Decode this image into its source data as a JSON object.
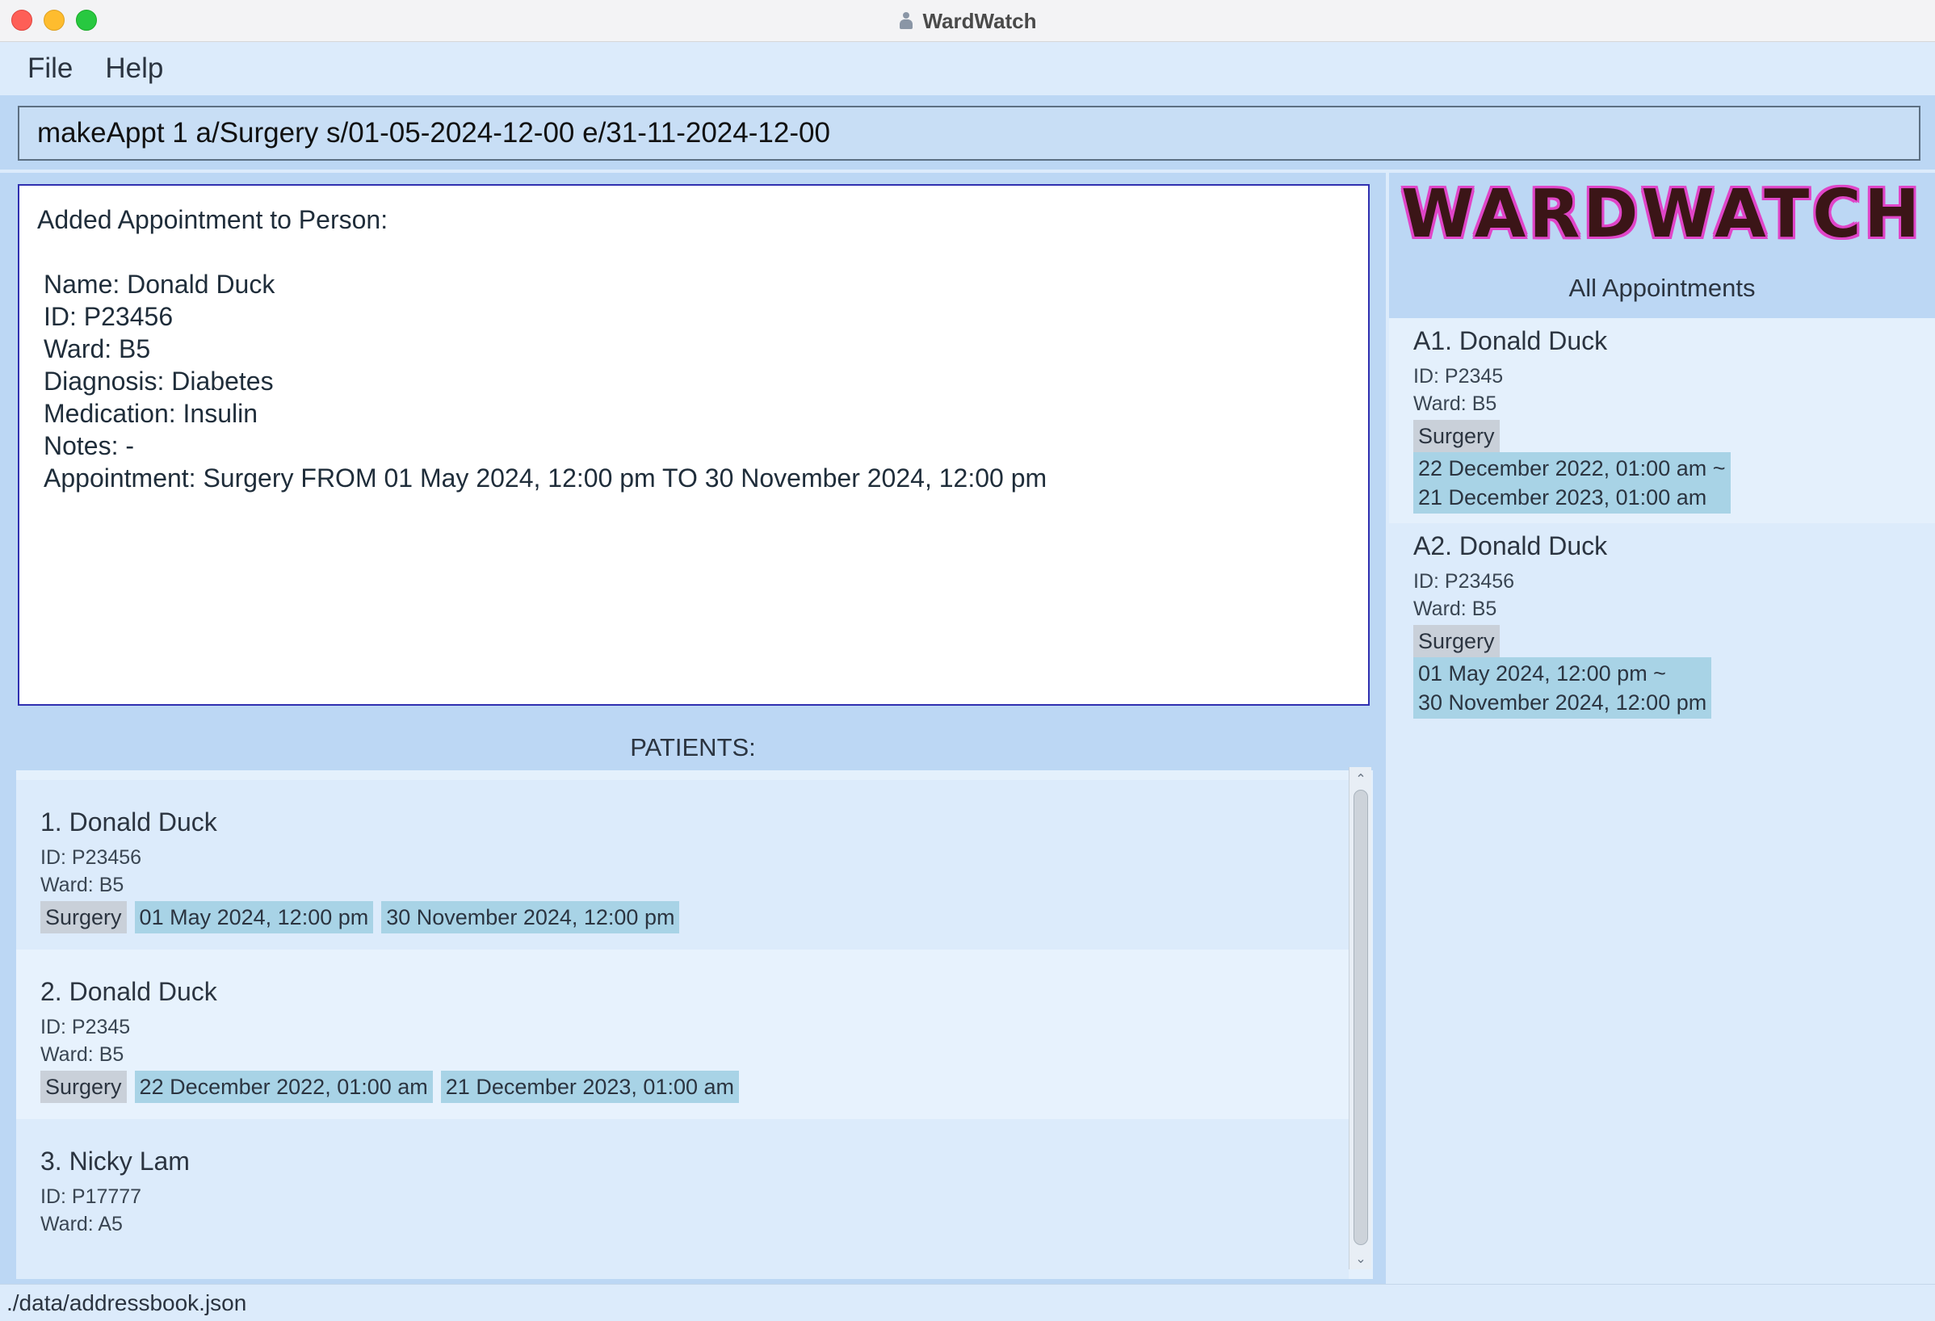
{
  "window": {
    "title": "WardWatch"
  },
  "menu": {
    "file": "File",
    "help": "Help"
  },
  "command": {
    "value": "makeAppt 1 a/Surgery s/01-05-2024-12-00 e/31-11-2024-12-00"
  },
  "result": {
    "lines": [
      "Added Appointment to Person:",
      "",
      "Name: Donald Duck",
      "ID: P23456",
      "Ward: B5",
      "Diagnosis: Diabetes",
      "Medication: Insulin",
      "Notes: -",
      "Appointment: Surgery FROM 01 May 2024, 12:00 pm TO 30 November 2024, 12:00 pm"
    ]
  },
  "patients": {
    "header": "PATIENTS:",
    "items": [
      {
        "name": "1.  Donald Duck",
        "id": "ID: P23456",
        "ward": "Ward: B5",
        "tag": "Surgery",
        "start": "01 May 2024, 12:00 pm",
        "end": "30 November 2024, 12:00 pm"
      },
      {
        "name": "2.  Donald Duck",
        "id": "ID: P2345",
        "ward": "Ward: B5",
        "tag": "Surgery",
        "start": "22 December 2022, 01:00 am",
        "end": "21 December 2023, 01:00 am"
      },
      {
        "name": "3.  Nicky Lam",
        "id": "ID: P17777",
        "ward": "Ward: A5"
      }
    ]
  },
  "appointments": {
    "logo": "WARDWATCH",
    "header": "All Appointments",
    "items": [
      {
        "name": "A1.  Donald Duck",
        "id": "ID: P2345",
        "ward": "Ward: B5",
        "tag": "Surgery",
        "range_line1": "22 December 2022, 01:00 am ~",
        "range_line2": "21 December 2023, 01:00 am"
      },
      {
        "name": "A2.  Donald Duck",
        "id": "ID: P23456",
        "ward": "Ward: B5",
        "tag": "Surgery",
        "range_line1": "01 May 2024, 12:00 pm ~",
        "range_line2": "30 November 2024, 12:00 pm"
      }
    ]
  },
  "status": {
    "path": "./data/addressbook.json"
  }
}
